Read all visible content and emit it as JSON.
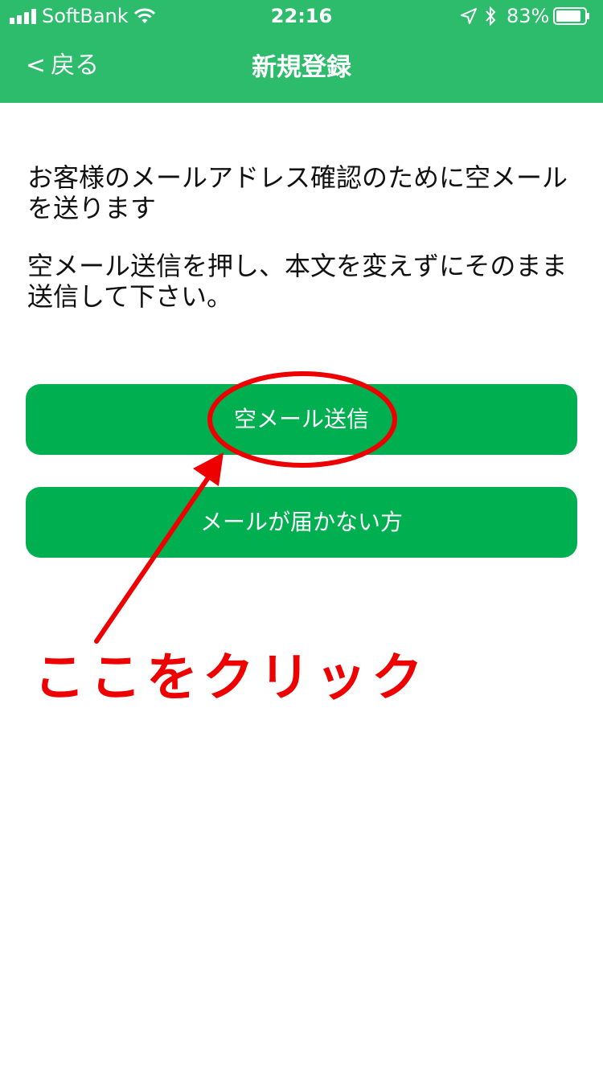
{
  "status_bar": {
    "carrier": "SoftBank",
    "time": "22:16",
    "battery_percent": "83%"
  },
  "nav": {
    "back_label": "戻る",
    "title": "新規登録"
  },
  "instructions": {
    "line1": "お客様のメールアドレス確認のために空メールを送ります",
    "line2": "空メール送信を押し、本文を変えずにそのまま送信して下さい。"
  },
  "buttons": {
    "send_empty_mail": "空メール送信",
    "mail_not_received": "メールが届かない方"
  },
  "annotation": {
    "text": "ここをクリック"
  },
  "colors": {
    "header_green": "#2dbb6c",
    "button_green": "#00b050",
    "annotation_red": "#ee0000"
  }
}
